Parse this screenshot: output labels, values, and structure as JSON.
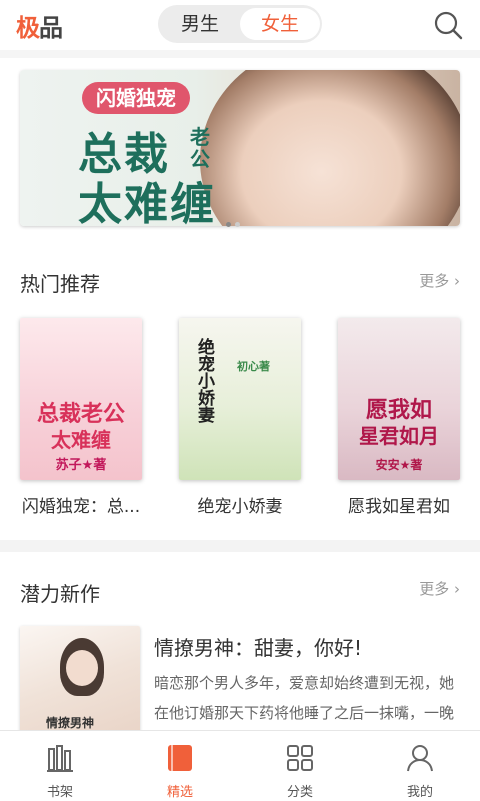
{
  "header": {
    "logo_accent": "极",
    "logo_rest": "品",
    "tabs": [
      {
        "label": "男生",
        "selected": false
      },
      {
        "label": "女生",
        "selected": true
      }
    ],
    "search_icon": "search-icon"
  },
  "banner": {
    "pill": "闪婚独宠",
    "line1": "总裁",
    "line1_small": "老公",
    "line2": "太难缠",
    "page_count": 2,
    "current_page": 1
  },
  "hot": {
    "title": "热门推荐",
    "more": "更多 ›",
    "books": [
      {
        "name": "闪婚独宠：总...",
        "cover_title": "总裁老公",
        "cover_title2": "太难缠",
        "cover_author": "苏子★著",
        "cover_bg": "#fbe3e6"
      },
      {
        "name": "绝宠小娇妻",
        "cover_title": "绝宠小娇妻",
        "cover_author": "初心著",
        "cover_bg": "#eef3e6"
      },
      {
        "name": "愿我如星君如",
        "cover_title": "愿我如",
        "cover_title2": "星君如月",
        "cover_author": "安安★著",
        "cover_bg": "#f4e7ea"
      }
    ]
  },
  "new": {
    "title": "潜力新作",
    "more": "更多 ›",
    "book": {
      "cover_label": "情撩男神",
      "title": "情撩男神：甜妻，你好!",
      "desc": "暗恋那个男人多年，爱意却始终遭到无视，她在他订婚那天下药将他睡了之后一抹嘴，一晚满足的消失了"
    }
  },
  "tabbar": {
    "items": [
      {
        "label": "书架",
        "icon": "bookshelf-icon",
        "active": false
      },
      {
        "label": "精选",
        "icon": "featured-icon",
        "active": true
      },
      {
        "label": "分类",
        "icon": "category-icon",
        "active": false
      },
      {
        "label": "我的",
        "icon": "profile-icon",
        "active": false
      }
    ]
  },
  "colors": {
    "accent": "#f0603a",
    "banner_text": "#1e6f5c"
  }
}
